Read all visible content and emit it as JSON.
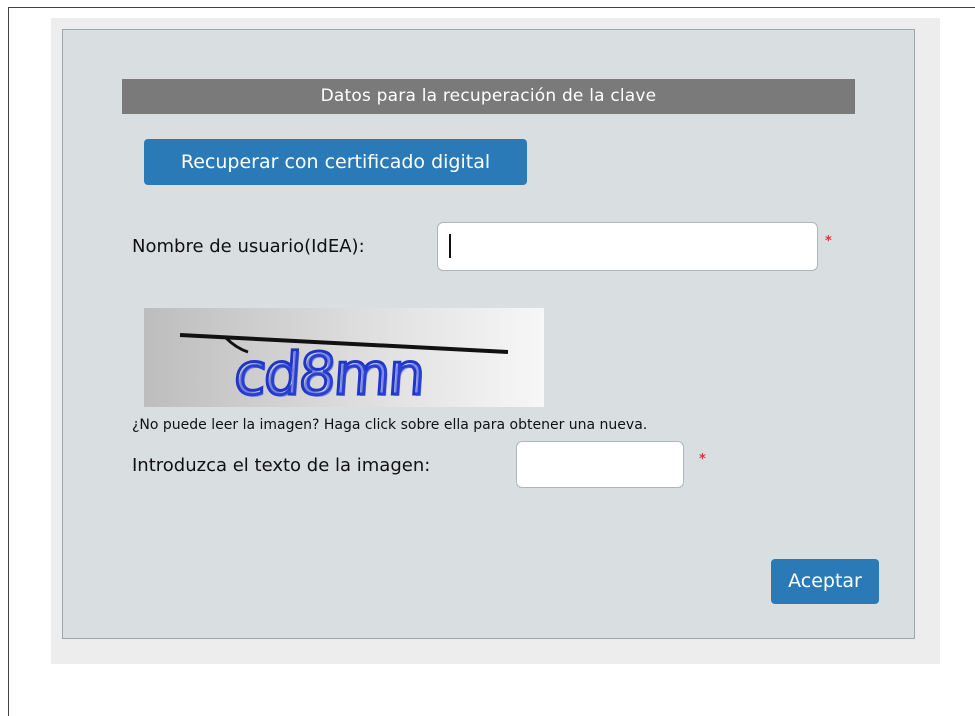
{
  "form": {
    "title": "Datos para la recuperación de la clave",
    "certificate_button_label": "Recuperar con certificado digital",
    "username_label": "Nombre de usuario(IdEA):",
    "username_value": "",
    "required_mark": "*",
    "captcha_text": "cd8mn",
    "captcha_help": "¿No puede leer la imagen? Haga click sobre ella para obtener una nueva.",
    "captcha_input_label": "Introduzca el texto de la imagen:",
    "captcha_input_value": "",
    "accept_button_label": "Aceptar"
  },
  "colors": {
    "button_blue": "#2a7ab8",
    "title_bar": "#7a7a7a",
    "panel_bg": "#d9dfe1",
    "required_red": "#e0312f",
    "captcha_ink": "#1f35c8"
  }
}
